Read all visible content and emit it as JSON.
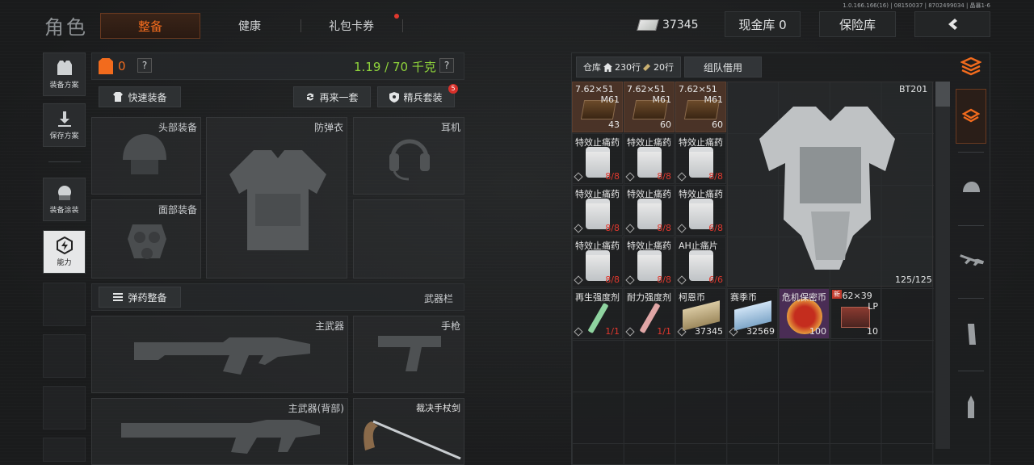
{
  "header": {
    "title": "角色",
    "tabs": [
      {
        "label": "整备",
        "active": true
      },
      {
        "label": "健康"
      },
      {
        "label": "礼包卡券",
        "dot": true
      }
    ],
    "money": "37345",
    "cash_vault": "现金库 0",
    "safe": "保险库",
    "version": "1.0.166.166(16) | 08150037 | 8702499034 | 晶暴1-6"
  },
  "sidebar": {
    "items": [
      "装备方案",
      "保存方案",
      "装备涂装",
      "能力"
    ]
  },
  "loadout": {
    "armor_value": "0",
    "help": "?",
    "weight": "1.19 / 70 千克",
    "quick_equip": "快速装备",
    "again": "再来一套",
    "elite": "精兵套装",
    "elite_badge": "5",
    "slots": {
      "head": "头部装备",
      "vest": "防弹衣",
      "ear": "耳机",
      "face": "面部装备"
    },
    "ammo_btn": "弹药整备",
    "weapon_bar": "武器栏",
    "weapons": {
      "primary": "主武器",
      "pistol": "手枪",
      "primary_back": "主武器(背部)",
      "melee": "裁决手杖剑"
    }
  },
  "storage": {
    "tab_label": "仓库",
    "rows": "230行",
    "rows2": "20行",
    "team_tab": "组队借用",
    "preview_name": "BT201",
    "preview_count": "125/125",
    "items": [
      {
        "t": "7.62×51",
        "t2": "M61",
        "c": "43",
        "amber": true
      },
      {
        "t": "7.62×51",
        "t2": "M61",
        "c": "60",
        "amber": true
      },
      {
        "t": "7.62×51",
        "t2": "M61",
        "c": "60",
        "amber": true
      },
      {
        "t": "特效止痛药",
        "c": "8/8",
        "red": true
      },
      {
        "t": "特效止痛药",
        "c": "8/8",
        "red": true
      },
      {
        "t": "特效止痛药",
        "c": "8/8",
        "red": true
      },
      {
        "t": "特效止痛药",
        "c": "8/8",
        "red": true
      },
      {
        "t": "特效止痛药",
        "c": "8/8",
        "red": true
      },
      {
        "t": "特效止痛药",
        "c": "6/8",
        "red": true
      },
      {
        "t": "特效止痛药",
        "c": "8/8",
        "red": true
      },
      {
        "t": "特效止痛药",
        "c": "8/8",
        "red": true
      },
      {
        "t": "AH止痛片",
        "c": "6/6",
        "red": true
      },
      {
        "t": "再生强度剂",
        "c": "1/1",
        "red": true
      },
      {
        "t": "耐力强度剂",
        "c": "1/1",
        "red": true
      },
      {
        "t": "柯恩币",
        "c": "37345"
      },
      {
        "t": "赛季币",
        "c": "32569"
      },
      {
        "t": "危机保密币",
        "c": "100"
      },
      {
        "t": "7.62×39",
        "t2": "LP",
        "c": "10",
        "badge": "新"
      }
    ]
  },
  "colors": {
    "accent": "#f26b1d",
    "weight_green": "#8fd43b",
    "red": "#e0382e"
  }
}
